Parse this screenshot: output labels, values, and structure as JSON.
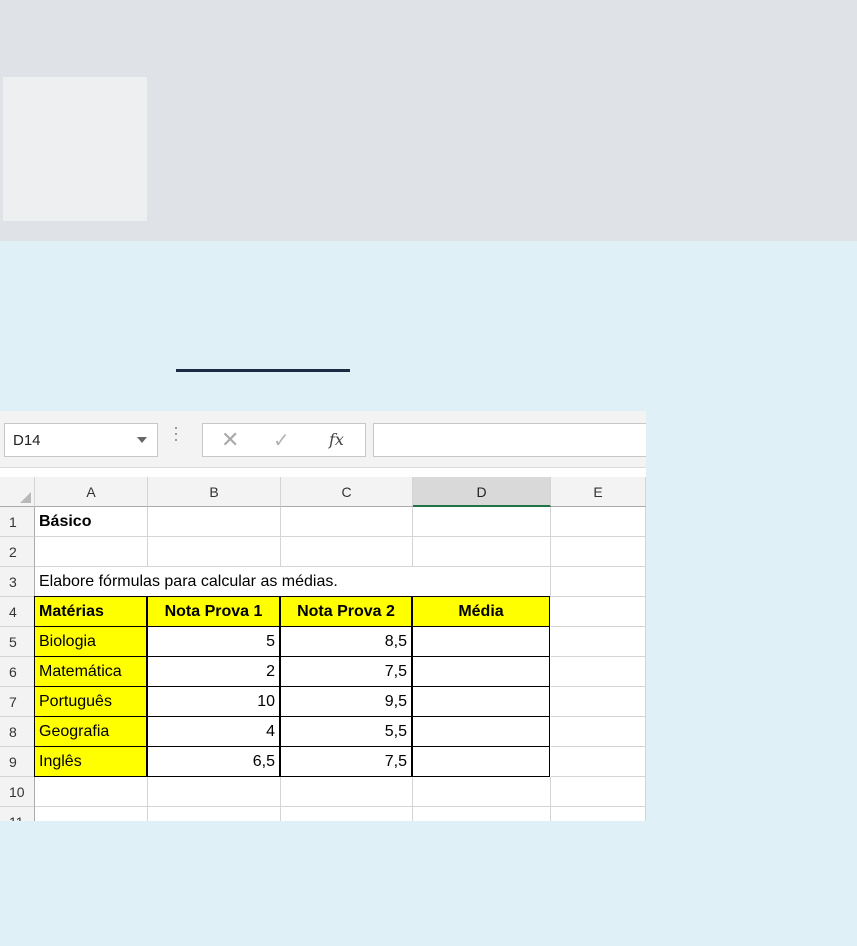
{
  "sheet": {
    "name_box": "D14",
    "fx_label": "fx",
    "cancel_symbol": "✕",
    "confirm_symbol": "✓",
    "columns": [
      "A",
      "B",
      "C",
      "D",
      "E"
    ],
    "selected_column": "D",
    "rows": [
      {
        "num": "1",
        "A": "Básico"
      },
      {
        "num": "2"
      },
      {
        "num": "3",
        "A": "Elabore fórmulas para calcular as médias."
      },
      {
        "num": "4",
        "A": "Matérias",
        "B": "Nota Prova 1",
        "C": "Nota Prova 2",
        "D": "Média"
      },
      {
        "num": "5",
        "A": "Biologia",
        "B": "5",
        "C": "8,5",
        "D": ""
      },
      {
        "num": "6",
        "A": "Matemática",
        "B": "2",
        "C": "7,5",
        "D": ""
      },
      {
        "num": "7",
        "A": "Português",
        "B": "10",
        "C": "9,5",
        "D": ""
      },
      {
        "num": "8",
        "A": "Geografia",
        "B": "4",
        "C": "5,5",
        "D": ""
      },
      {
        "num": "9",
        "A": "Inglês",
        "B": "6,5",
        "C": "7,5",
        "D": ""
      },
      {
        "num": "10"
      },
      {
        "num": "11"
      }
    ]
  },
  "colors": {
    "highlight": "#ffff00",
    "selected_col_accent": "#217346",
    "background": "#dff0f6",
    "top_band": "#dfe2e7"
  }
}
